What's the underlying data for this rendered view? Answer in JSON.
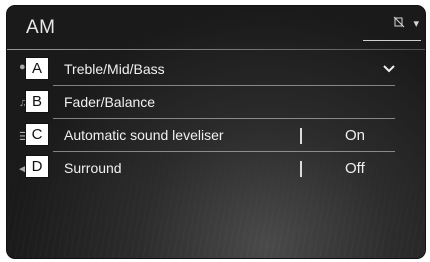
{
  "screen": {
    "title": "AM",
    "status_icon": "no-signal-icon",
    "status_dropdown": "▾"
  },
  "rows": [
    {
      "callout": "A",
      "label": "Treble/Mid/Bass",
      "value": "",
      "chevron": "⌄"
    },
    {
      "callout": "B",
      "label": "Fader/Balance",
      "value": ""
    },
    {
      "callout": "C",
      "label": "Automatic sound leveliser",
      "value": "On"
    },
    {
      "callout": "D",
      "label": "Surround",
      "value": "Off"
    }
  ]
}
